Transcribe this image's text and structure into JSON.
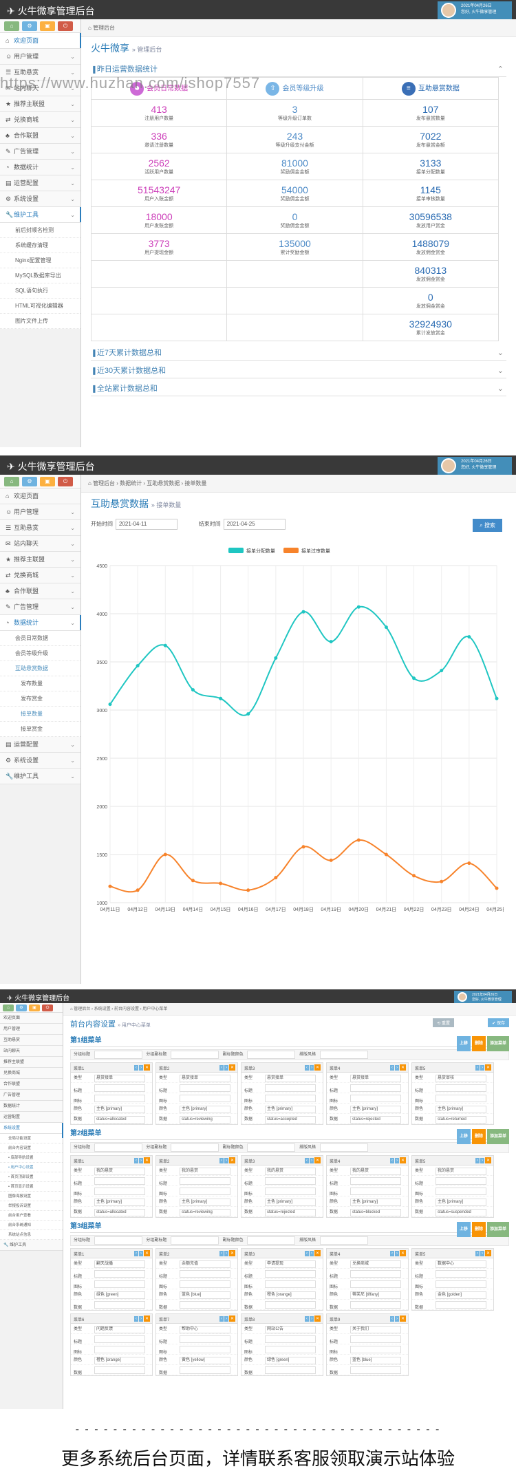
{
  "app_title": "火牛微享管理后台",
  "user": {
    "date": "2021年04月26日",
    "greeting": "您好, 火牛微享管理"
  },
  "shot1": {
    "nav": [
      {
        "icon": "⌂",
        "label": "欢迎页面",
        "active": true
      },
      {
        "icon": "☺",
        "label": "用户管理"
      },
      {
        "icon": "☰",
        "label": "互助悬赏"
      },
      {
        "icon": "✉",
        "label": "站内聊天"
      },
      {
        "icon": "★",
        "label": "推荐主联盟"
      },
      {
        "icon": "⇄",
        "label": "兑换商城"
      },
      {
        "icon": "♣",
        "label": "合作联盟"
      },
      {
        "icon": "✎",
        "label": "广告管理"
      },
      {
        "icon": "◔",
        "label": "数据统计"
      },
      {
        "icon": "▤",
        "label": "运营配置"
      },
      {
        "icon": "⚙",
        "label": "系统设置"
      },
      {
        "icon": "🔧",
        "label": "维护工具",
        "active": true
      }
    ],
    "subnav": [
      "前后封顺名检测",
      "系统缓存清理",
      "Nginx配置管理",
      "MySQL数据库导出",
      "SQL语句执行",
      "HTML可视化编辑器",
      "图片文件上传"
    ],
    "crumb": "管理后台",
    "page_title": "火牛微享",
    "page_sub": "» 管理后台",
    "watermark": "https://www.huzhan.com/ishop7557",
    "section_title": "昨日运营数据统计",
    "cols": [
      "会员日常数据",
      "会员等级升级",
      "互助悬赏数据"
    ],
    "rows": [
      [
        [
          "413",
          "注册用户数量"
        ],
        [
          "3",
          "等级升级订单数"
        ],
        [
          "107",
          "发布悬赏数量"
        ]
      ],
      [
        [
          "336",
          "邀请注册数量"
        ],
        [
          "243",
          "等级升级支付金额"
        ],
        [
          "7022",
          "发布悬赏金额"
        ]
      ],
      [
        [
          "2562",
          "活跃用户数量"
        ],
        [
          "81000",
          "奖励佣金金额"
        ],
        [
          "3133",
          "接单分配数量"
        ]
      ],
      [
        [
          "51543247",
          "用户入账金额"
        ],
        [
          "54000",
          "奖励佣金金额"
        ],
        [
          "1145",
          "接单审核数量"
        ]
      ],
      [
        [
          "18000",
          "用户发账金额"
        ],
        [
          "0",
          "奖励佣金金额"
        ],
        [
          "30596538",
          "发放用户赏金"
        ]
      ],
      [
        [
          "3773",
          "用户提现金额"
        ],
        [
          "135000",
          "累计奖励金额"
        ],
        [
          "1488079",
          "发放佣金赏金"
        ]
      ],
      [
        [
          "",
          ""
        ],
        [
          "",
          ""
        ],
        [
          "840313",
          "发放佣金赏金"
        ]
      ],
      [
        [
          "",
          ""
        ],
        [
          "",
          ""
        ],
        [
          "0",
          "发放佣金赏金"
        ]
      ],
      [
        [
          "",
          ""
        ],
        [
          "",
          ""
        ],
        [
          "32924930",
          "累计发放赏金"
        ]
      ]
    ],
    "collapsed": [
      "近7天累计数据总和",
      "近30天累计数据总和",
      "全站累计数据总和"
    ]
  },
  "shot2": {
    "nav_top": [
      {
        "icon": "⌂",
        "label": "欢迎页面"
      },
      {
        "icon": "☺",
        "label": "用户管理"
      },
      {
        "icon": "☰",
        "label": "互助悬赏"
      },
      {
        "icon": "✉",
        "label": "站内聊天"
      },
      {
        "icon": "★",
        "label": "推荐主联盟"
      },
      {
        "icon": "⇄",
        "label": "兑换商城"
      },
      {
        "icon": "♣",
        "label": "合作联盟"
      },
      {
        "icon": "✎",
        "label": "广告管理"
      },
      {
        "icon": "◔",
        "label": "数据统计",
        "active": true
      }
    ],
    "subnav": [
      "会员日常数据",
      "会员等级升级",
      "互助悬赏数据"
    ],
    "subsub": [
      "发布数量",
      "发布赏金",
      "接单数量",
      "接单赏金"
    ],
    "nav_bottom": [
      {
        "icon": "▤",
        "label": "运营配置"
      },
      {
        "icon": "⚙",
        "label": "系统设置"
      },
      {
        "icon": "🔧",
        "label": "维护工具"
      }
    ],
    "crumb": "管理后台 › 数据统计 › 互助悬赏数据 › 接单数量",
    "page_title": "互助悬赏数据",
    "page_sub": "» 接单数量",
    "start_label": "开始时间",
    "start_value": "2021-04-11",
    "end_label": "结束时间",
    "end_value": "2021-04-25",
    "search_btn": "搜索"
  },
  "chart_data": {
    "type": "line",
    "categories": [
      "04月11日",
      "04月12日",
      "04月13日",
      "04月14日",
      "04月15日",
      "04月16日",
      "04月17日",
      "04月18日",
      "04月19日",
      "04月20日",
      "04月21日",
      "04月22日",
      "04月23日",
      "04月24日",
      "04月25日"
    ],
    "series": [
      {
        "name": "接单分配数量",
        "color": "#1fc6c2",
        "values": [
          3060,
          3460,
          3670,
          3210,
          3120,
          2960,
          3540,
          4020,
          3710,
          4070,
          3860,
          3330,
          3410,
          3760,
          3120
        ]
      },
      {
        "name": "接单过审数量",
        "color": "#f7832b",
        "values": [
          1170,
          1130,
          1500,
          1230,
          1200,
          1130,
          1260,
          1580,
          1440,
          1650,
          1500,
          1280,
          1220,
          1410,
          1150
        ]
      }
    ],
    "y_ticks": [
      "1000",
      "1500",
      "2000",
      "2500",
      "3000",
      "3500",
      "4000",
      "4500"
    ],
    "ylim": [
      1000,
      4500
    ],
    "legend": "top-center",
    "grid": true
  },
  "shot3": {
    "app_title": "火牛微享管理后台",
    "nav": [
      "欢迎页面",
      "用户管理",
      "互助悬赏",
      "站内聊天",
      "推荐主联盟",
      "兑换商城",
      "合作联盟",
      "广告管理",
      "数据统计",
      "运营配置",
      "系统设置"
    ],
    "subnav": [
      "全局功能设置",
      "前台内容设置",
      "• 底部导航设置",
      "• 用户中心设置",
      "• 首页顶部设置",
      "• 首页显示设置",
      "图像海报设置",
      "举报投诉设置",
      "前台用户查看",
      "前台系统通知",
      "系统站点信息"
    ],
    "crumb": "管理后台 › 系统设置 › 前台内容设置 › 用户中心菜单",
    "page_title": "前台内容设置",
    "page_sub": "» 用户中心菜单",
    "menus": [
      {
        "title": "第1组菜单",
        "cards": [
          {
            "name": "菜单1",
            "type": "悬赏接单",
            "color": "主色 [primary]",
            "data": "status=allocated"
          },
          {
            "name": "菜单2",
            "type": "悬赏接单",
            "color": "主色 [primary]",
            "data": "status=reviewing"
          },
          {
            "name": "菜单3",
            "type": "悬赏接单",
            "color": "主色 [primary]",
            "data": "status=accepted"
          },
          {
            "name": "菜单4",
            "type": "悬赏接单",
            "color": "主色 [primary]",
            "data": "status=rejected"
          },
          {
            "name": "菜单5",
            "type": "悬赏审核",
            "color": "主色 [primary]",
            "data": "status=returned"
          }
        ]
      },
      {
        "title": "第2组菜单",
        "cards": [
          {
            "name": "菜单1",
            "type": "我的悬赏",
            "color": "主色 [primary]",
            "data": "status=allocated"
          },
          {
            "name": "菜单2",
            "type": "我的悬赏",
            "color": "主色 [primary]",
            "data": "status=reviewing"
          },
          {
            "name": "菜单3",
            "type": "我的悬赏",
            "color": "主色 [primary]",
            "data": "status=rejected"
          },
          {
            "name": "菜单4",
            "type": "我的悬赏",
            "color": "主色 [primary]",
            "data": "status=blocked"
          },
          {
            "name": "菜单5",
            "type": "我的悬赏",
            "color": "主色 [primary]",
            "data": "status=suspended"
          }
        ]
      },
      {
        "title": "第3组菜单",
        "cards": [
          {
            "name": "菜单1",
            "type": "翻天战播",
            "color": "绿色 [green]",
            "data": ""
          },
          {
            "name": "菜单2",
            "type": "余额充值",
            "color": "蓝色 [blue]",
            "data": ""
          },
          {
            "name": "菜单3",
            "type": "申请提现",
            "color": "橙色 [orange]",
            "data": ""
          },
          {
            "name": "菜单4",
            "type": "兑换商城",
            "color": "蒂芙尼 [tiffany]",
            "data": ""
          },
          {
            "name": "菜单5",
            "type": "数据中心",
            "color": "金色 [golden]",
            "data": ""
          },
          {
            "name": "菜单6",
            "type": "问题反馈",
            "color": "橙色 [orange]",
            "data": ""
          },
          {
            "name": "菜单7",
            "type": "帮助中心",
            "color": "黄色 [yellow]",
            "data": ""
          },
          {
            "name": "菜单8",
            "type": "网站公告",
            "color": "绿色 [green]",
            "data": ""
          },
          {
            "name": "菜单9",
            "type": "关于我们",
            "color": "蓝色 [blue]",
            "data": ""
          }
        ]
      }
    ]
  },
  "footer": {
    "dashes": "- - - - - - - - - - - - - - - - - - - - - - - - - - - - - - - - - - - - - - -",
    "text": "更多系统后台页面，详情联系客服领取演示站体验"
  }
}
